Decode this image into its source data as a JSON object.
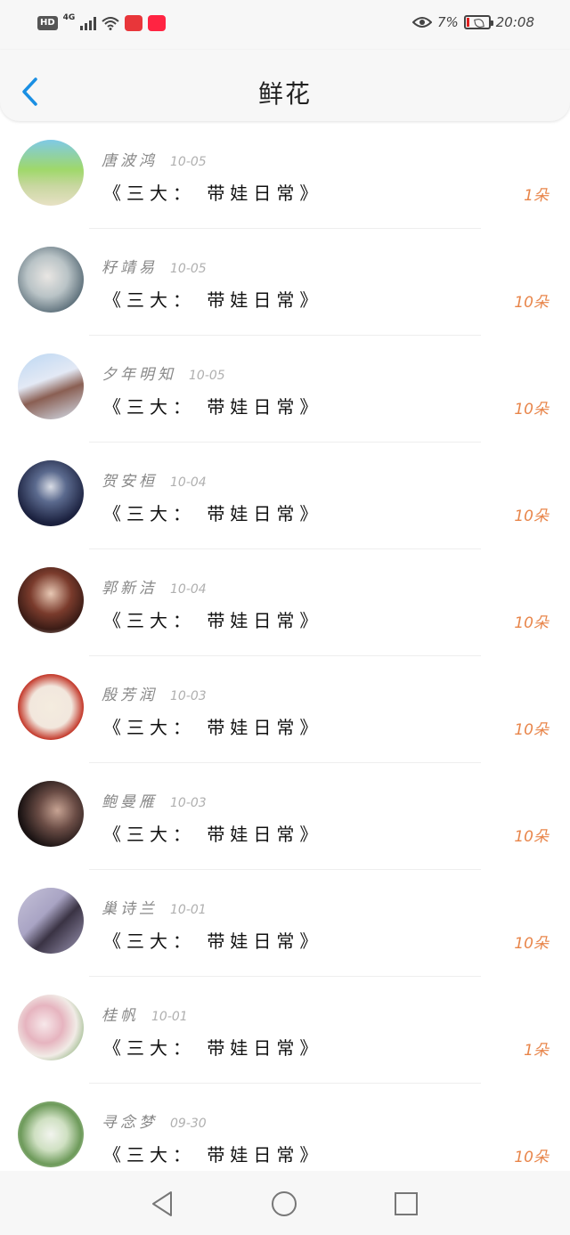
{
  "status_bar": {
    "hd": "HD",
    "network": "4G",
    "battery_percent": "7%",
    "time": "20:08"
  },
  "header": {
    "title": "鲜花"
  },
  "colors": {
    "accent": "#1a8fe3",
    "count": "#e8854a",
    "name": "#888888"
  },
  "items": [
    {
      "name": "唐波鸿",
      "date": "10-05",
      "book": "《三大：  带娃日常》",
      "count": "1朵"
    },
    {
      "name": "籽靖易",
      "date": "10-05",
      "book": "《三大：  带娃日常》",
      "count": "10朵"
    },
    {
      "name": "夕年明知",
      "date": "10-05",
      "book": "《三大：  带娃日常》",
      "count": "10朵"
    },
    {
      "name": "贺安桓",
      "date": "10-04",
      "book": "《三大：  带娃日常》",
      "count": "10朵"
    },
    {
      "name": "郭新洁",
      "date": "10-04",
      "book": "《三大：  带娃日常》",
      "count": "10朵"
    },
    {
      "name": "殷芳润",
      "date": "10-03",
      "book": "《三大：  带娃日常》",
      "count": "10朵"
    },
    {
      "name": "鲍曼雁",
      "date": "10-03",
      "book": "《三大：  带娃日常》",
      "count": "10朵"
    },
    {
      "name": "巢诗兰",
      "date": "10-01",
      "book": "《三大：  带娃日常》",
      "count": "10朵"
    },
    {
      "name": "桂帆",
      "date": "10-01",
      "book": "《三大：  带娃日常》",
      "count": "1朵"
    },
    {
      "name": "寻念梦",
      "date": "09-30",
      "book": "《三大：  带娃日常》",
      "count": "10朵"
    }
  ]
}
